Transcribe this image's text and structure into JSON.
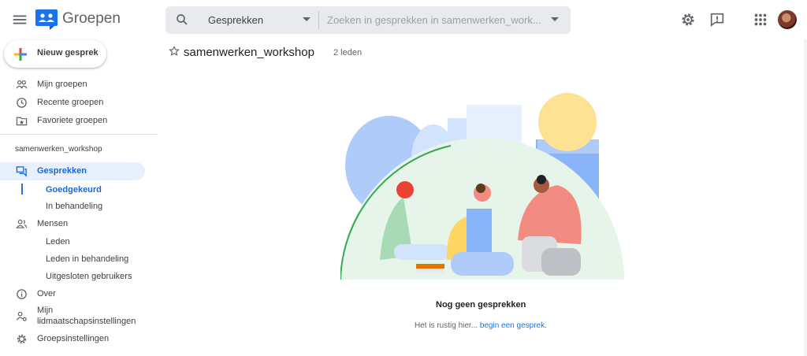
{
  "app": {
    "title": "Groepen"
  },
  "search": {
    "scope": "Gesprekken",
    "placeholder": "Zoeken in gesprekken in samenwerken_work..."
  },
  "sidebar": {
    "new_button": "Nieuw gesprek",
    "top_items": [
      {
        "label": "Mijn groepen",
        "icon": "groups-icon"
      },
      {
        "label": "Recente groepen",
        "icon": "clock-icon"
      },
      {
        "label": "Favoriete groepen",
        "icon": "star-folder-icon"
      }
    ],
    "group_name": "samenwerken_workshop",
    "sections": {
      "conversations": "Gesprekken",
      "approved": "Goedgekeurd",
      "pending": "In behandeling",
      "people": "Mensen",
      "members": "Leden",
      "pending_members": "Leden in behandeling",
      "banned_users": "Uitgesloten gebruikers",
      "about": "Over",
      "membership_settings_line1": "Mijn",
      "membership_settings_line2": "lidmaatschapsinstellingen",
      "group_settings": "Groepsinstellingen"
    }
  },
  "main": {
    "group_title": "samenwerken_workshop",
    "member_count": "2 leden",
    "empty_title": "Nog geen gesprekken",
    "empty_text": "Het is rustig hier...",
    "empty_link": "begin een gesprek."
  },
  "colors": {
    "accent": "#1a73e8",
    "active_bg": "#e8f0fe"
  }
}
